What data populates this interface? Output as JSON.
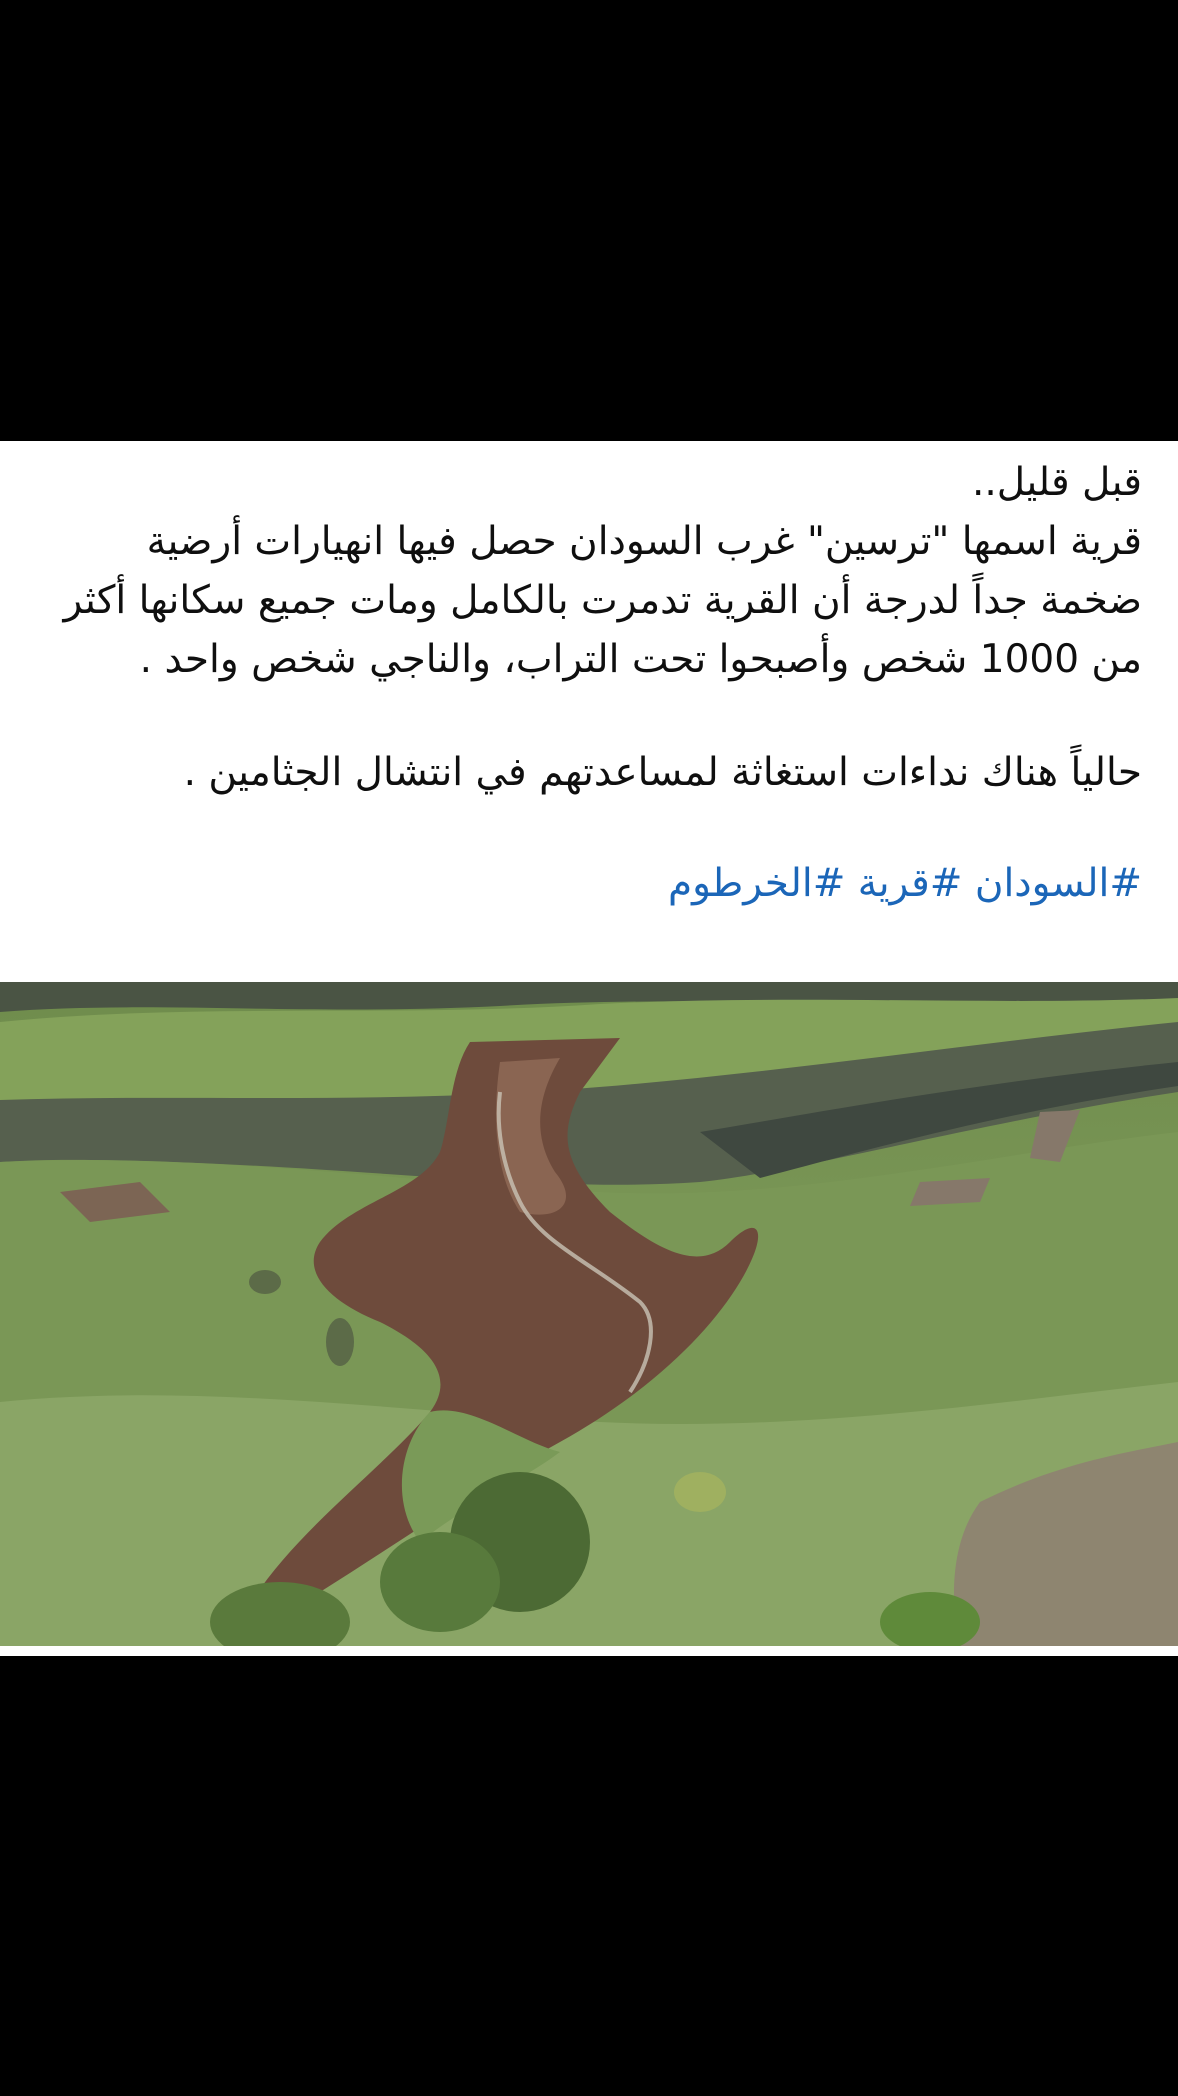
{
  "post": {
    "line1": "قبل قليل..",
    "paragraph1": "قرية اسمها \"ترسين\" غرب السودان حصل فيها انهيارات أرضية ضخمة جداً لدرجة أن القرية تدمرت بالكامل ومات جميع سكانها أكثر من 1000 شخص وأصبحوا تحت التراب، والناجي شخص واحد .",
    "paragraph2": "حالياً هناك نداءات استغاثة لمساعدتهم في انتشال الجثامين .",
    "hashtags": [
      "#السودان",
      "#قرية",
      "#الخرطوم"
    ]
  },
  "photo": {
    "subject": "landslide-hillside",
    "colors": {
      "grass": "#7d9a58",
      "mud": "#6e4b3c",
      "rock": "#4d5548"
    }
  }
}
